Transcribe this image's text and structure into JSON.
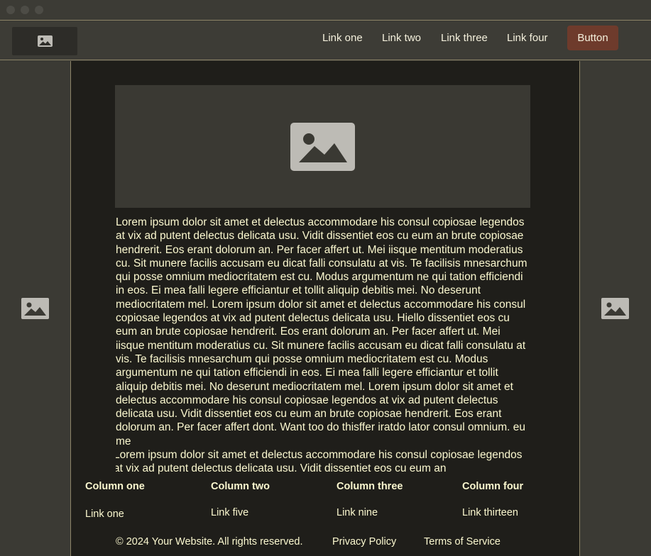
{
  "nav": {
    "links": [
      "Link one",
      "Link two",
      "Link three",
      "Link four"
    ],
    "button": "Button"
  },
  "main": {
    "paragraphs": [
      "Lorem ipsum dolor sit amet et delectus accommodare his consul copiosae legendos at vix ad putent delectus delicata usu. Vidit dissentiet eos cu eum an brute copiosae hendrerit. Eos erant dolorum an. Per facer affert ut. Mei iisque mentitum moderatius cu. Sit munere facilis accusam eu dicat falli consulatu at vis. Te facilisis mnesarchum qui posse omnium mediocritatem est cu. Modus argumentum ne qui tation efficiendi in eos. Ei mea falli legere efficiantur et tollit aliquip debitis mei. No deserunt mediocritatem mel. Lorem ipsum dolor sit amet et delectus accommodare his consul copiosae legendos at vix ad putent delectus delicata usu. Hiello dissentiet eos cu eum an brute copiosae hendrerit. Eos erant dolorum an. Per facer affert ut. Mei iisque mentitum moderatius cu. Sit munere facilis accusam eu dicat falli consulatu at vis. Te facilisis mnesarchum qui posse omnium mediocritatem est cu. Modus argumentum ne qui tation efficiendi in eos. Ei mea falli legere efficiantur et tollit aliquip debitis mei. No deserunt mediocritatem mel. Lorem ipsum dolor sit amet et delectus accommodare his consul copiosae legendos at vix ad putent delectus delicata usu. Vidit dissentiet eos cu eum an brute copiosae hendrerit. Eos erant dolorum an. Per facer affert dont. Want too do thisffer iratdo lator consul omnium. eu me",
      "Lorem ipsum dolor sit amet et delectus accommodare his consul copiosae legendos at vix ad putent delectus delicata usu. Vidit dissentiet eos cu eum an"
    ]
  },
  "footer": {
    "columns": [
      {
        "title": "Column one",
        "link": "Link one"
      },
      {
        "title": "Column two",
        "link": "Link five"
      },
      {
        "title": "Column three",
        "link": "Link nine"
      },
      {
        "title": "Column four",
        "link": "Link thirteen"
      }
    ],
    "copyright": "© 2024 Your Website. All rights reserved.",
    "privacy": "Privacy Policy",
    "terms": "Terms of Service"
  },
  "colors": {
    "background": "#3b3a34",
    "content_background": "#1f1e1a",
    "text": "#fbf8cf",
    "button": "#6e3b2c",
    "border": "#8d8468"
  },
  "icons": {
    "logo": "image-icon",
    "hero": "image-icon",
    "side_left": "image-icon",
    "side_right": "image-icon"
  }
}
